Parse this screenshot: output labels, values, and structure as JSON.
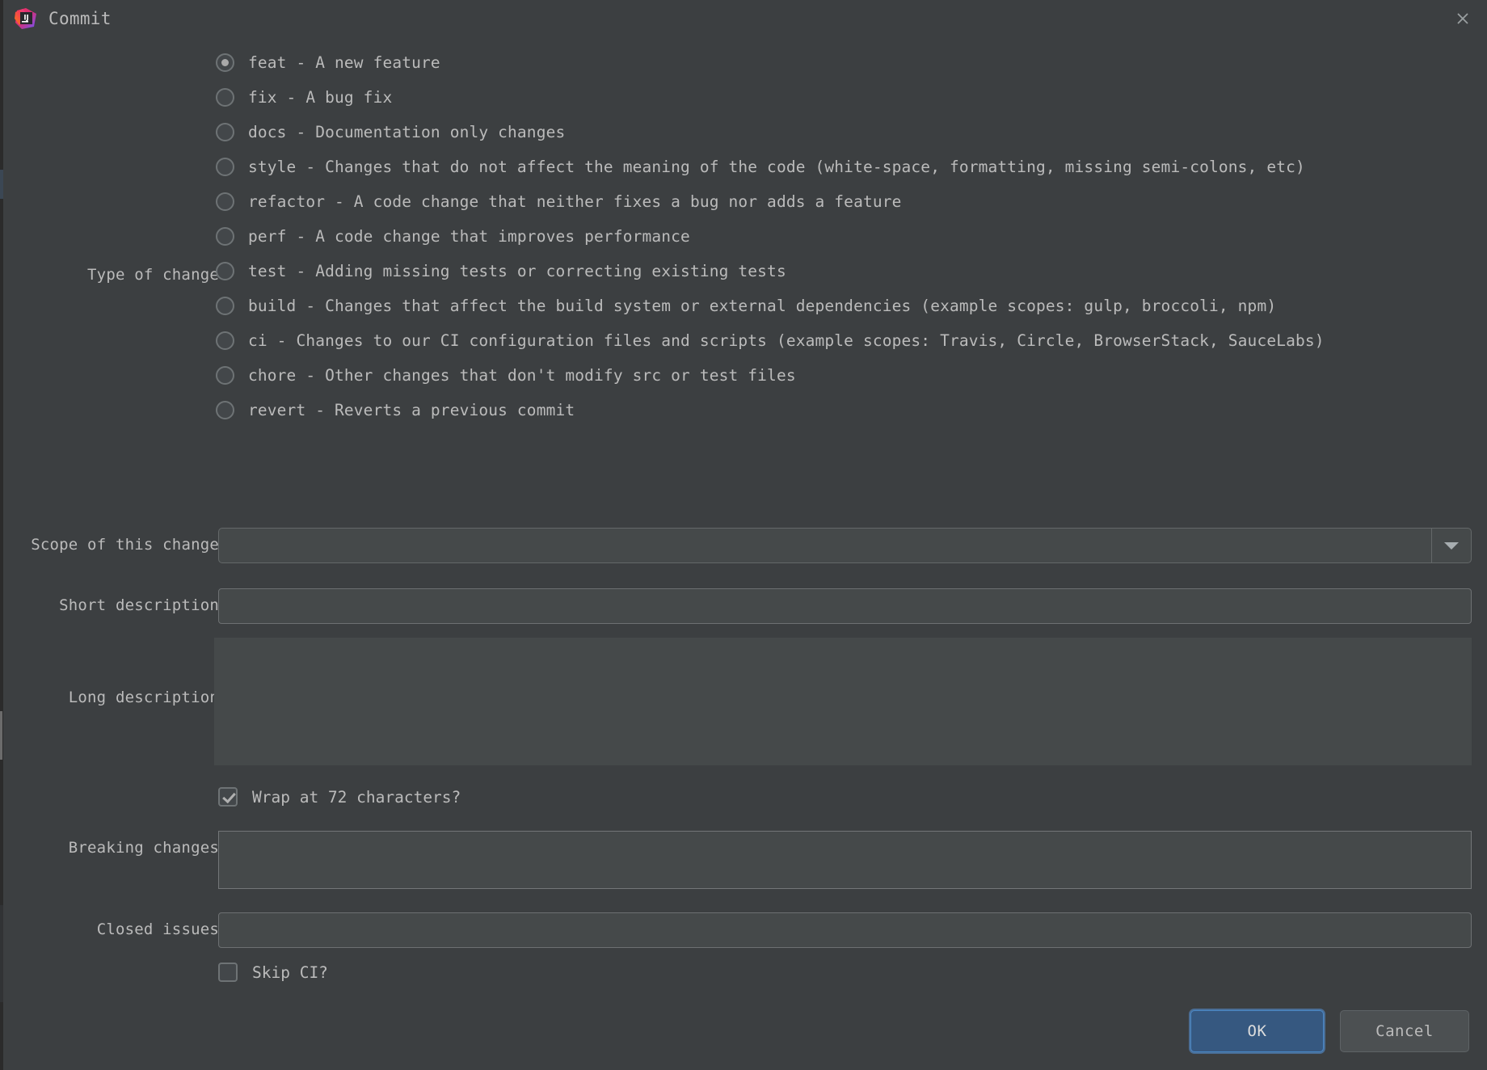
{
  "window": {
    "title": "Commit",
    "app_icon": "intellij-idea-logo",
    "close_icon": "close-icon"
  },
  "form": {
    "type_of_change": {
      "label": "Type of change",
      "selected": "feat",
      "options": [
        {
          "value": "feat",
          "label": "feat - A new feature"
        },
        {
          "value": "fix",
          "label": "fix - A bug fix"
        },
        {
          "value": "docs",
          "label": "docs - Documentation only changes"
        },
        {
          "value": "style",
          "label": "style - Changes that do not affect the meaning of the code (white-space, formatting, missing semi-colons, etc)"
        },
        {
          "value": "refactor",
          "label": "refactor - A code change that neither fixes a bug nor adds a feature"
        },
        {
          "value": "perf",
          "label": "perf - A code change that improves performance"
        },
        {
          "value": "test",
          "label": "test - Adding missing tests or correcting existing tests"
        },
        {
          "value": "build",
          "label": "build - Changes that affect the build system or external dependencies (example scopes: gulp, broccoli, npm)"
        },
        {
          "value": "ci",
          "label": "ci - Changes to our CI configuration files and scripts (example scopes: Travis, Circle, BrowserStack, SauceLabs)"
        },
        {
          "value": "chore",
          "label": "chore - Other changes that don't modify src or test files"
        },
        {
          "value": "revert",
          "label": "revert - Reverts a previous commit"
        }
      ]
    },
    "scope": {
      "label": "Scope of this change",
      "value": "",
      "placeholder": "",
      "dropdown_icon": "chevron-down-icon"
    },
    "short_description": {
      "label": "Short description",
      "value": "",
      "placeholder": ""
    },
    "long_description": {
      "label": "Long description",
      "value": "",
      "placeholder": ""
    },
    "wrap": {
      "label": "Wrap at 72 characters?",
      "checked": true
    },
    "breaking_changes": {
      "label": "Breaking changes",
      "value": "",
      "placeholder": ""
    },
    "closed_issues": {
      "label": "Closed issues",
      "value": "",
      "placeholder": ""
    },
    "skip_ci": {
      "label": "Skip CI?",
      "checked": false
    }
  },
  "footer": {
    "ok_label": "OK",
    "cancel_label": "Cancel"
  },
  "colors": {
    "dialog_bg": "#3c3f41",
    "field_bg": "#45494a",
    "text": "#bbbbbb",
    "ok_button": "#365880",
    "ok_focus_ring": "#4a88c7"
  }
}
